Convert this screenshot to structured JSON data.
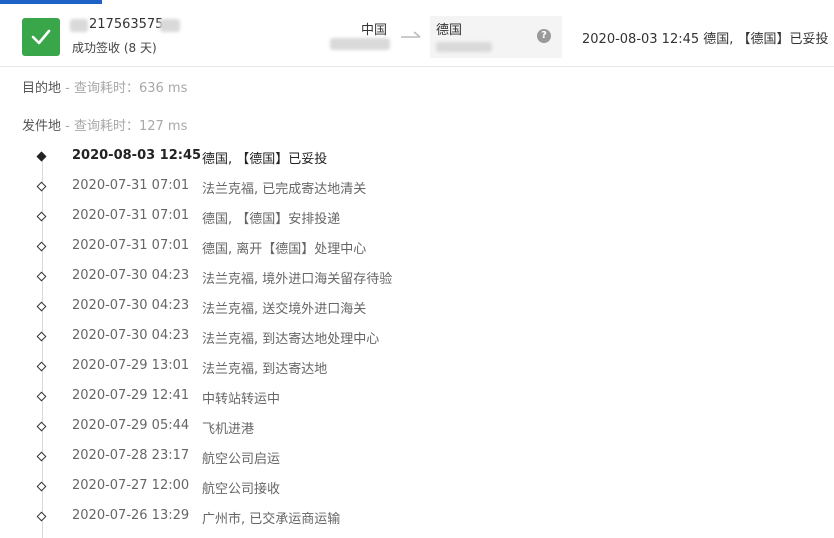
{
  "summary": {
    "tracking_number": "217563575",
    "status": "成功签收 (8 天)",
    "origin": "中国",
    "destination": "德国",
    "help_label": "?",
    "latest_event": "2020-08-03 12:45  德国, 【德国】已妥投"
  },
  "destination_info": {
    "label": "目的地",
    "query_time": " - 查询耗时：636 ms"
  },
  "origin_info": {
    "label": "发件地",
    "query_time": " - 查询耗时：127 ms"
  },
  "events": [
    {
      "time": "2020-08-03 12:45",
      "desc": "德国, 【德国】已妥投"
    },
    {
      "time": "2020-07-31 07:01",
      "desc": "法兰克福, 已完成寄达地清关"
    },
    {
      "time": "2020-07-31 07:01",
      "desc": "德国, 【德国】安排投递"
    },
    {
      "time": "2020-07-31 07:01",
      "desc": "德国, 离开【德国】处理中心"
    },
    {
      "time": "2020-07-30 04:23",
      "desc": "法兰克福, 境外进口海关留存待验"
    },
    {
      "time": "2020-07-30 04:23",
      "desc": "法兰克福, 送交境外进口海关"
    },
    {
      "time": "2020-07-30 04:23",
      "desc": "法兰克福, 到达寄达地处理中心"
    },
    {
      "time": "2020-07-29 13:01",
      "desc": "法兰克福, 到达寄达地"
    },
    {
      "time": "2020-07-29 12:41",
      "desc": "中转站转运中"
    },
    {
      "time": "2020-07-29 05:44",
      "desc": "飞机进港"
    },
    {
      "time": "2020-07-28 23:17",
      "desc": "航空公司启运"
    },
    {
      "time": "2020-07-27 12:00",
      "desc": "航空公司接收"
    },
    {
      "time": "2020-07-26 13:29",
      "desc": "广州市, 已交承运商运输"
    }
  ],
  "colors": {
    "status_green": "#3aa64a",
    "accent_blue": "#1e62c8"
  }
}
